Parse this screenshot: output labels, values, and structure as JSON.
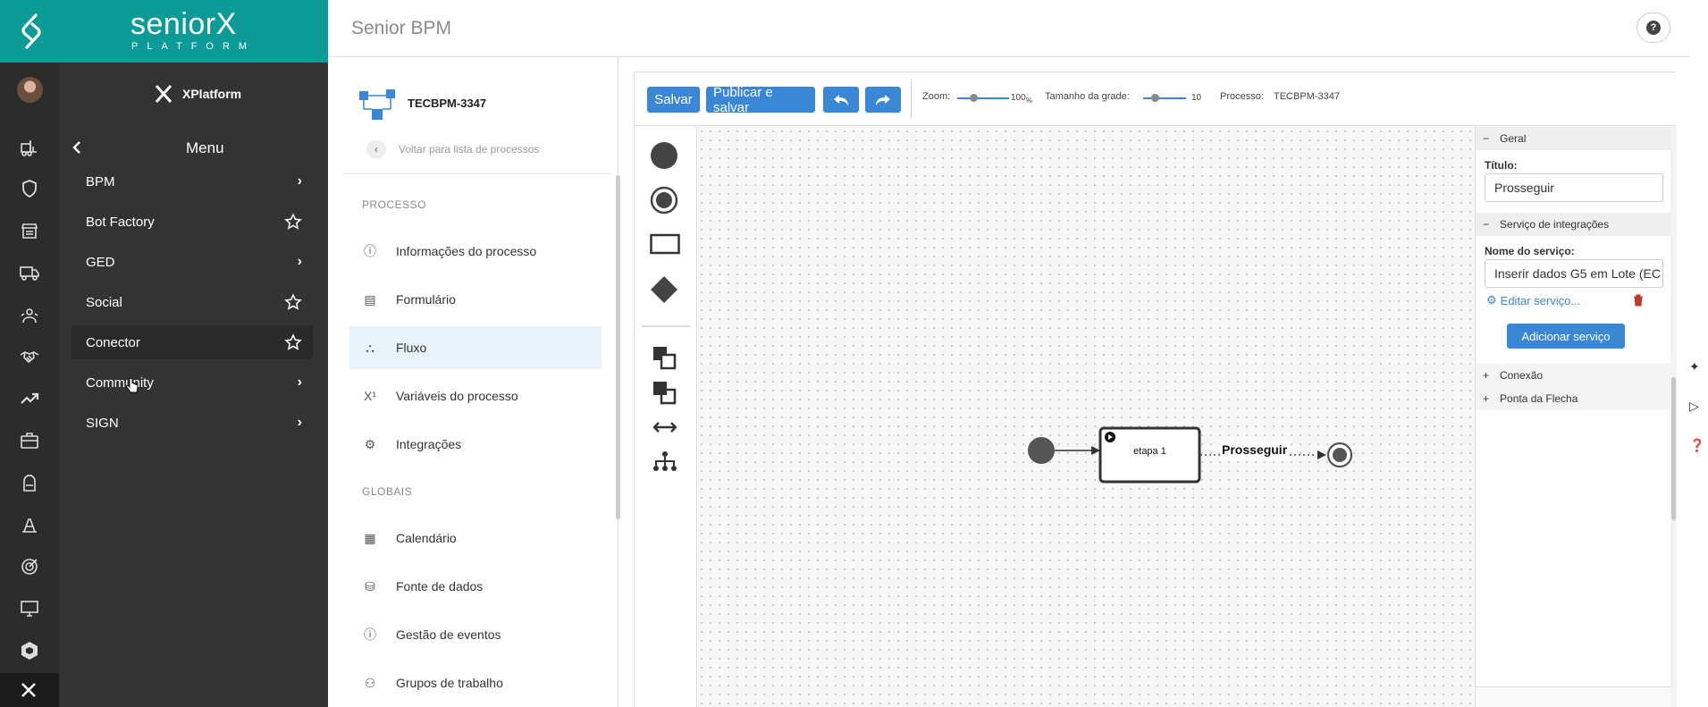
{
  "brand": {
    "name": "seniorX",
    "sub": "PLATFORM"
  },
  "menu": {
    "product": "XPlatform",
    "title": "Menu",
    "items": [
      {
        "label": "BPM",
        "trail": "chevron-right"
      },
      {
        "label": "Bot Factory",
        "trail": "star"
      },
      {
        "label": "GED",
        "trail": "chevron-right"
      },
      {
        "label": "Social",
        "trail": "star"
      },
      {
        "label": "Conector",
        "trail": "star"
      },
      {
        "label": "Community",
        "trail": "chevron-right"
      },
      {
        "label": "SIGN",
        "trail": "chevron-right"
      }
    ]
  },
  "header": {
    "title": "Senior BPM",
    "help": "?"
  },
  "process_sidebar": {
    "process_id": "TECBPM-3347",
    "back_label": "Voltar para lista de processos",
    "section_process": "PROCESSO",
    "process_items": [
      "Informações do processo",
      "Formulário",
      "Fluxo",
      "Variáveis do processo",
      "Integrações"
    ],
    "section_global": "GLOBAIS",
    "global_items": [
      "Calendário",
      "Fonte de dados",
      "Gestão de eventos",
      "Grupos de trabalho"
    ]
  },
  "toolbar": {
    "save": "Salvar",
    "publish": "Publicar e salvar",
    "zoom_label": "Zoom:",
    "zoom_value": "100",
    "zoom_unit": "%",
    "grid_label": "Tamanho da grade:",
    "grid_value": "10",
    "process_label": "Processo:",
    "process_value": "TECBPM-3347"
  },
  "diagram": {
    "task_label": "etapa 1",
    "connection_label": "Prosseguir"
  },
  "properties": {
    "general": "Geral",
    "title_label": "Título:",
    "title_value": "Prosseguir",
    "integration_section": "Serviço de integrações",
    "service_name_label": "Nome do serviço:",
    "service_name_value": "Inserir dados G5 em Lote (EC",
    "edit_service": "Editar serviço...",
    "add_service": "Adicionar serviço",
    "connection": "Conexão",
    "arrow_tip": "Ponta da Flecha"
  },
  "colors": {
    "teal": "#0c9b96",
    "menu_bg": "#333333",
    "rail_bg": "#2c2c2c",
    "accent": "#3a87d6"
  }
}
